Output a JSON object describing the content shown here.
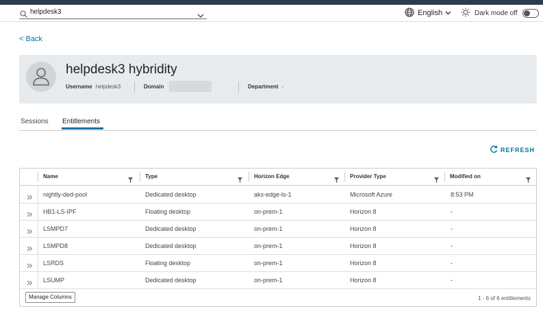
{
  "header": {
    "search_value": "helpdesk3",
    "language": "English",
    "dark_mode_label": "Dark mode off",
    "dark_mode_on": false
  },
  "back_label": "< Back",
  "user": {
    "display_name": "helpdesk3 hybridity",
    "username_label": "Username",
    "username": "helpdesk3",
    "domain_label": "Domain",
    "domain": "",
    "department_label": "Department",
    "department": "-"
  },
  "tabs": [
    {
      "label": "Sessions",
      "active": false
    },
    {
      "label": "Entitlements",
      "active": true
    }
  ],
  "refresh_label": "REFRESH",
  "table": {
    "columns": [
      "Name",
      "Type",
      "Horizon Edge",
      "Provider Type",
      "Modified on"
    ],
    "rows": [
      [
        "nightly-ded-pool",
        "Dedicated desktop",
        "aks-edge-ls-1",
        "Microsoft Azure",
        "8:53 PM"
      ],
      [
        "HB1-LS-IPF",
        "Floating desktop",
        "on-prem-1",
        "Horizon 8",
        "-"
      ],
      [
        "LSMPD7",
        "Dedicated desktop",
        "on-prem-1",
        "Horizon 8",
        "-"
      ],
      [
        "LSMPD8",
        "Dedicated desktop",
        "on-prem-1",
        "Horizon 8",
        "-"
      ],
      [
        "LSRDS",
        "Floating desktop",
        "on-prem-1",
        "Horizon 8",
        "-"
      ],
      [
        "LSUMP",
        "Dedicated desktop",
        "on-prem-1",
        "Horizon 8",
        "-"
      ]
    ],
    "manage_columns_label": "Manage Columns",
    "count_label": "1 - 6 of 6 entitlements"
  },
  "icons": {
    "search": "search-icon",
    "dropdown": "chevron-down-icon",
    "globe": "globe-icon",
    "sun": "sun-icon",
    "avatar": "user-icon",
    "refresh": "refresh-icon",
    "filter": "filter-icon",
    "expand": "double-chevron-right-icon"
  },
  "colors": {
    "accent": "#0072a3",
    "topbar": "#2d3b4a",
    "card_bg": "#e8ebed"
  }
}
